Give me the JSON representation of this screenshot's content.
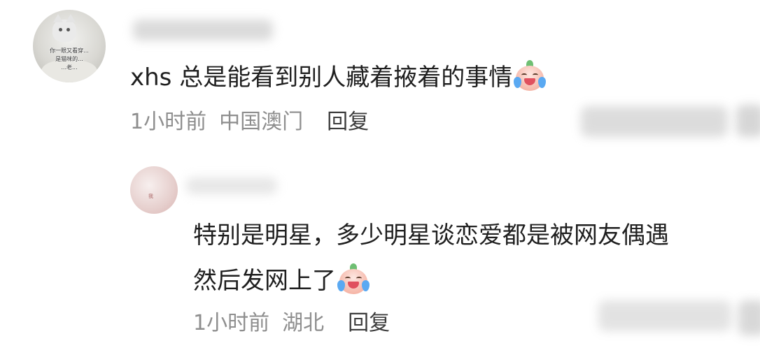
{
  "comments": [
    {
      "text": "xhs 总是能看到别人藏着掖着的事情",
      "emoji": "crying-laughing-peach-emoji",
      "time": "1小时前",
      "location": "中国澳门",
      "reply_label": "回复",
      "avatar_caption": [
        "你一眼又看穿...",
        "是猫咪的...",
        "...老..."
      ]
    },
    {
      "text_line1": "特别是明星，多少明星谈恋爱都是被网友偶遇",
      "text_line2": "然后发网上了",
      "emoji": "crying-laughing-peach-emoji",
      "time": "1小时前",
      "location": "湖北",
      "reply_label": "回复",
      "avatar_caption": "我"
    }
  ],
  "colors": {
    "text": "#1f1f1f",
    "meta": "#8e8e8e",
    "reply": "#3c3c3c",
    "background": "#ffffff"
  }
}
